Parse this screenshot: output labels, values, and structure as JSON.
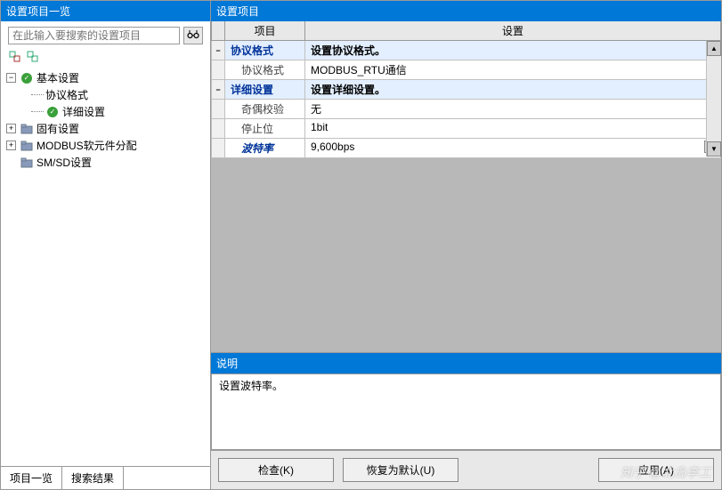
{
  "left": {
    "title": "设置项目一览",
    "search_placeholder": "在此输入要搜索的设置项目",
    "tabs": [
      "项目一览",
      "搜索结果"
    ]
  },
  "tree": {
    "root": {
      "basic": "基本设置",
      "protocol": "协议格式",
      "detail": "详细设置",
      "fixed": "固有设置",
      "modbus": "MODBUS软元件分配",
      "smsd": "SM/SD设置"
    }
  },
  "right": {
    "title": "设置项目",
    "col_item": "项目",
    "col_value": "设置",
    "grid": {
      "proto_header_key": "协议格式",
      "proto_header_val": "设置协议格式。",
      "proto_key": "协议格式",
      "proto_val": "MODBUS_RTU通信",
      "detail_header_key": "详细设置",
      "detail_header_val": "设置详细设置。",
      "parity_key": "奇偶校验",
      "parity_val": "无",
      "stop_key": "停止位",
      "stop_val": "1bit",
      "baud_key": "波特率",
      "baud_val": "9,600bps"
    }
  },
  "desc": {
    "title": "说明",
    "body": "设置波特率。"
  },
  "buttons": {
    "check": "检查(K)",
    "default": "恢复为默认(U)",
    "apply": "应用(A)"
  },
  "watermark": "知乎 @北岛李工"
}
